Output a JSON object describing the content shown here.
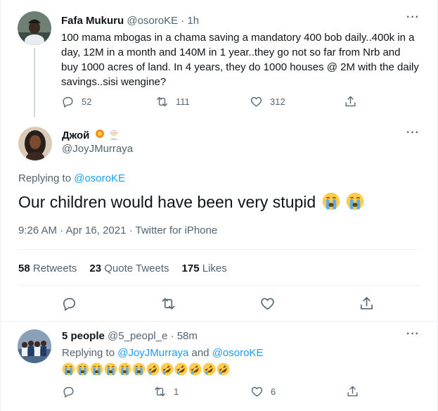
{
  "parent_tweet": {
    "name": "Fafa Mukuru",
    "handle": "@osoroKE",
    "separator": "·",
    "time": "1h",
    "text": "100 mama mbogas in a chama saving a mandatory 400 bob daily..400k in a day, 12M in a month and 140M in 1 year..they go not so far from Nrb and buy 1000 acres of land. In 4 years, they do 1000 houses @ 2M with the daily savings..sisi wengine?",
    "replies": "52",
    "retweets": "111",
    "likes": "312",
    "more_label": "···"
  },
  "main_tweet": {
    "name": "Джой",
    "handle": "@JoyJMurraya",
    "replying_prefix": "Replying to",
    "replying_to": "@osoroKE",
    "text": "Our children would have been very stupid",
    "timestamp": "9:26 AM · Apr 16, 2021 · Twitter for iPhone",
    "stats": {
      "retweets_count": "58",
      "retweets_label": "Retweets",
      "quotes_count": "23",
      "quotes_label": "Quote Tweets",
      "likes_count": "175",
      "likes_label": "Likes"
    },
    "more_label": "···"
  },
  "reply_tweet": {
    "name": "5 people",
    "handle": "@5_peopl_e",
    "separator": "·",
    "time": "58m",
    "replying_prefix": "Replying to",
    "replying_to_1": "@JoyJMurraya",
    "replying_and": "and",
    "replying_to_2": "@osoroKE",
    "emoji_sequence": [
      "crying-face",
      "crying-face",
      "crying-face",
      "crying-face",
      "crying-face",
      "crying-face",
      "rofl",
      "rofl",
      "rofl",
      "rofl",
      "rofl",
      "rofl"
    ],
    "replies": "",
    "retweets": "1",
    "likes": "6",
    "more_label": "···"
  },
  "colors": {
    "text": "#0f1419",
    "secondary": "#536471",
    "link": "#1d9bf0",
    "divider": "#eff3f4"
  }
}
